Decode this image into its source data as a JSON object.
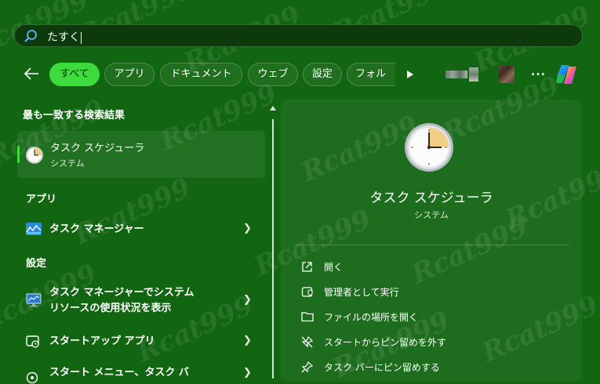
{
  "search": {
    "query": "たすく"
  },
  "filters": {
    "items": [
      {
        "label": "すべて",
        "active": true
      },
      {
        "label": "アプリ",
        "active": false
      },
      {
        "label": "ドキュメント",
        "active": false
      },
      {
        "label": "ウェブ",
        "active": false
      },
      {
        "label": "設定",
        "active": false
      },
      {
        "label": "フォルダー",
        "active": false
      }
    ],
    "more_label": "..."
  },
  "watermark": {
    "text": "Rcat999"
  },
  "left_pane": {
    "best_match_header": "最も一致する検索結果",
    "best_match": {
      "title": "タスク スケジューラ",
      "subtitle": "システム",
      "icon": "clock-icon"
    },
    "apps_header": "アプリ",
    "apps": [
      {
        "label": "タスク マネージャー",
        "icon": "task-manager-icon"
      }
    ],
    "settings_header": "設定",
    "settings": [
      {
        "line1": "タスク マネージャーでシステム",
        "line2": "リソースの使用状況を表示",
        "icon": "monitor-icon"
      },
      {
        "line1": "スタートアップ アプリ",
        "icon": "startup-apps-icon"
      },
      {
        "line1": "スタート メニュー、タスク バ",
        "icon": "start-menu-icon"
      }
    ]
  },
  "right_pane": {
    "title": "タスク スケジューラ",
    "subtitle": "システム",
    "actions": [
      {
        "label": "開く",
        "icon": "open-external-icon"
      },
      {
        "label": "管理者として実行",
        "icon": "shield-admin-icon"
      },
      {
        "label": "ファイルの場所を開く",
        "icon": "folder-icon"
      },
      {
        "label": "スタートからピン留めを外す",
        "icon": "unpin-icon"
      },
      {
        "label": "タスク バーにピン留めする",
        "icon": "pin-icon"
      }
    ]
  },
  "colors": {
    "background": "#126612",
    "accent": "#3cdc3c",
    "search_bg": "#0c3a0c"
  }
}
